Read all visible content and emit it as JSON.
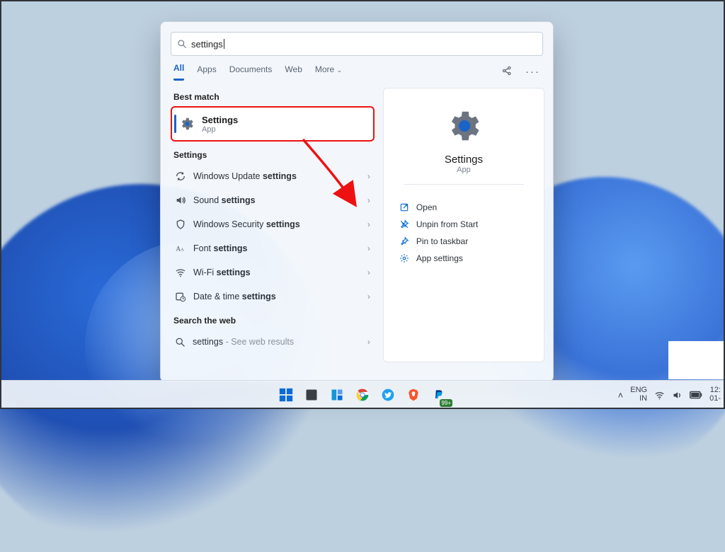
{
  "search": {
    "query": "settings"
  },
  "tabs": {
    "all": "All",
    "apps": "Apps",
    "documents": "Documents",
    "web": "Web",
    "more": "More"
  },
  "sections": {
    "best_match": "Best match",
    "settings_group": "Settings",
    "search_web": "Search the web"
  },
  "best_match": {
    "title": "Settings",
    "subtitle": "App"
  },
  "settings_results": [
    {
      "prefix": "Windows Update ",
      "bold": "settings"
    },
    {
      "prefix": "Sound ",
      "bold": "settings"
    },
    {
      "prefix": "Windows Security ",
      "bold": "settings"
    },
    {
      "prefix": "Font ",
      "bold": "settings"
    },
    {
      "prefix": "Wi-Fi ",
      "bold": "settings"
    },
    {
      "prefix": "Date & time ",
      "bold": "settings"
    }
  ],
  "web_result": {
    "term": "settings",
    "hint": " - See web results"
  },
  "details": {
    "title": "Settings",
    "subtitle": "App",
    "actions": {
      "open": "Open",
      "unpin_start": "Unpin from Start",
      "pin_taskbar": "Pin to taskbar",
      "app_settings": "App settings"
    }
  },
  "taskbar": {
    "badge_count": "99+",
    "lang1": "ENG",
    "lang2": "IN",
    "time": "12:",
    "date": "01-"
  }
}
